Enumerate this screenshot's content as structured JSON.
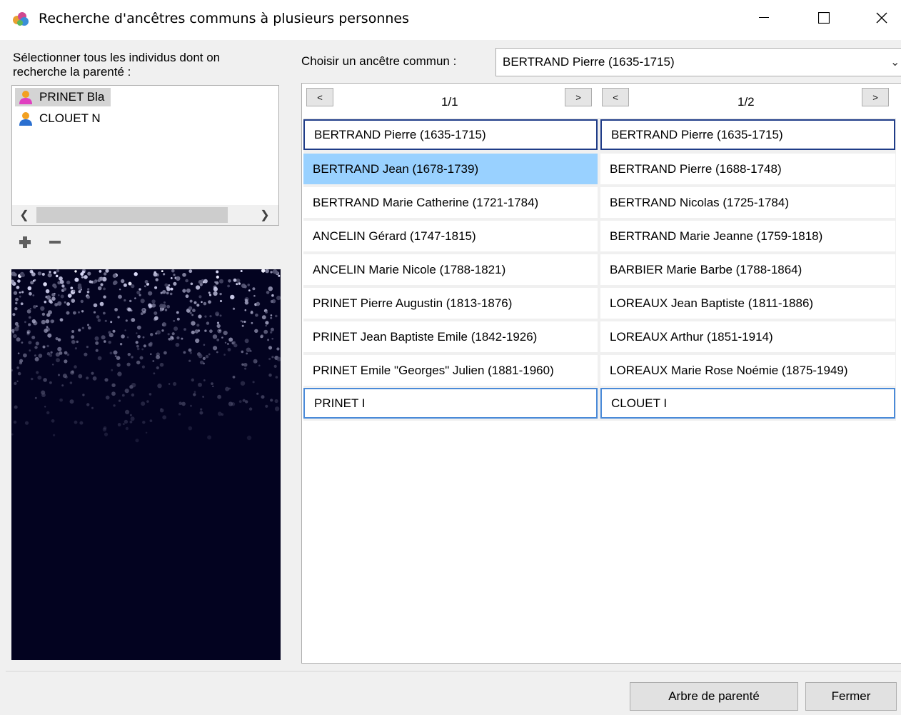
{
  "window": {
    "title": "Recherche d'ancêtres communs à plusieurs personnes",
    "icon": "app-palette-icon"
  },
  "left": {
    "label_line1": "Sélectionner tous les individus dont on",
    "label_line2": "recherche la parenté :",
    "persons": [
      {
        "name": "PRINET Bla",
        "icon": "person-female-icon",
        "selected": true
      },
      {
        "name": "CLOUET N",
        "icon": "person-male-icon",
        "selected": false
      }
    ],
    "add_icon": "plus-icon",
    "remove_icon": "minus-icon"
  },
  "ancestor": {
    "label": "Choisir un ancêtre commun :",
    "selected": "BERTRAND Pierre (1635-1715)"
  },
  "columns": [
    {
      "prev": "<",
      "next": ">",
      "page": "1/1",
      "entries": [
        "BERTRAND Pierre (1635-1715)",
        "BERTRAND Jean (1678-1739)",
        "BERTRAND Marie Catherine (1721-1784)",
        "ANCELIN Gérard (1747-1815)",
        "ANCELIN Marie Nicole (1788-1821)",
        "PRINET Pierre Augustin (1813-1876)",
        "PRINET Jean Baptiste Emile (1842-1926)",
        "PRINET Emile \"Georges\" Julien (1881-1960)",
        "PRINET I"
      ]
    },
    {
      "prev": "<",
      "next": ">",
      "page": "1/2",
      "entries": [
        "BERTRAND Pierre (1635-1715)",
        "BERTRAND Pierre (1688-1748)",
        "BERTRAND Nicolas (1725-1784)",
        "BERTRAND Marie Jeanne (1759-1818)",
        "BARBIER Marie Barbe (1788-1864)",
        "LOREAUX Jean Baptiste (1811-1886)",
        "LOREAUX Arthur (1851-1914)",
        "LOREAUX Marie Rose Noémie (1875-1949)",
        "CLOUET I"
      ]
    }
  ],
  "buttons": {
    "tree": "Arbre de parenté",
    "close": "Fermer"
  },
  "colors": {
    "highlight": "#99d1ff",
    "frame_dark": "#1f3c88",
    "frame_light": "#4a8ad8",
    "constellation_bg": "#030320"
  }
}
